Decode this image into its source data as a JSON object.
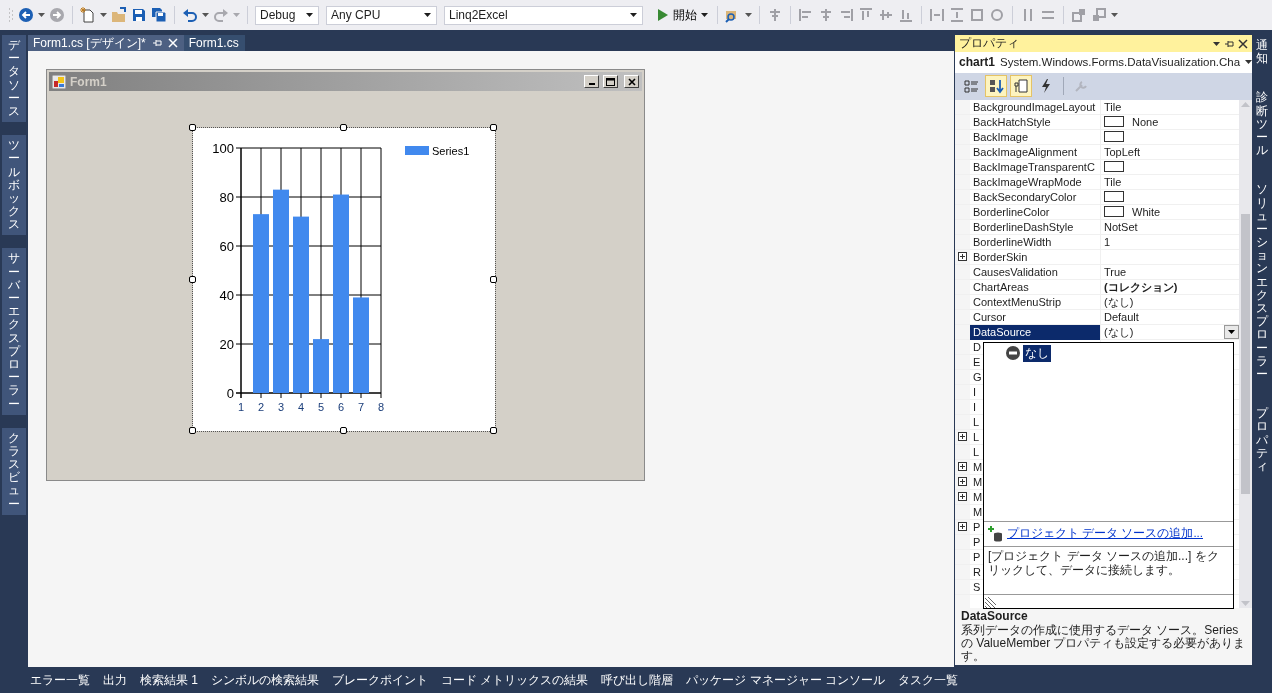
{
  "toolbar": {
    "configuration": "Debug",
    "platform": "Any CPU",
    "project": "Linq2Excel",
    "start_label": "開始"
  },
  "side_tabs_left": [
    "データソース",
    "ツールボックス",
    "サーバーエクスプローラー",
    "クラスビュー"
  ],
  "document_tabs": [
    {
      "label": "Form1.cs [デザイン]*",
      "selected": true
    },
    {
      "label": "Form1.cs",
      "selected": false
    }
  ],
  "form": {
    "title": "Form1",
    "chart": {
      "chart_data": {
        "type": "bar",
        "grid": true,
        "x": [
          2,
          3,
          4,
          5,
          6,
          7
        ],
        "xlim": [
          1,
          8
        ],
        "ylim": [
          0,
          100
        ],
        "xticks": [
          1,
          2,
          3,
          4,
          5,
          6,
          7,
          8
        ],
        "yticks": [
          0,
          20,
          40,
          60,
          80,
          100
        ],
        "series": [
          {
            "name": "Series1",
            "color": "#4189ee",
            "values": [
              73,
              83,
              72,
              22,
              81,
              39
            ]
          }
        ]
      }
    }
  },
  "properties": {
    "title": "プロパティ",
    "object_name": "chart1",
    "object_type": "System.Windows.Forms.DataVisualization.Cha",
    "toolbar": [
      {
        "kind": "categorized",
        "selected": false,
        "disabled": false
      },
      {
        "kind": "alphabetical",
        "selected": true,
        "disabled": false
      },
      {
        "kind": "property-pages",
        "selected": true,
        "disabled": false
      },
      {
        "kind": "events",
        "selected": false,
        "disabled": false
      },
      {
        "kind": "wrench",
        "selected": false,
        "disabled": true
      }
    ],
    "rows": [
      {
        "name": "BackgroundImageLayout",
        "value": "Tile",
        "swatch": false,
        "bold": false,
        "expander": false,
        "selected": false
      },
      {
        "name": "BackHatchStyle",
        "value": "None",
        "swatch": true,
        "bold": false,
        "expander": false,
        "selected": false
      },
      {
        "name": "BackImage",
        "swatch": true,
        "expander": false,
        "selected": false
      },
      {
        "name": "BackImageAlignment",
        "value": "TopLeft",
        "swatch": false,
        "bold": false,
        "expander": false,
        "selected": false
      },
      {
        "name": "BackImageTransparentC",
        "swatch": true,
        "expander": false,
        "selected": false
      },
      {
        "name": "BackImageWrapMode",
        "value": "Tile",
        "swatch": false,
        "bold": false,
        "expander": false,
        "selected": false
      },
      {
        "name": "BackSecondaryColor",
        "swatch": true,
        "expander": false,
        "selected": false
      },
      {
        "name": "BorderlineColor",
        "value": "White",
        "swatch": true,
        "bold": false,
        "expander": false,
        "selected": false
      },
      {
        "name": "BorderlineDashStyle",
        "value": "NotSet",
        "swatch": false,
        "bold": false,
        "expander": false,
        "selected": false
      },
      {
        "name": "BorderlineWidth",
        "value": "1",
        "swatch": false,
        "bold": false,
        "expander": false,
        "selected": false
      },
      {
        "name": "BorderSkin",
        "swatch": false,
        "expander": true,
        "selected": false
      },
      {
        "name": "CausesValidation",
        "value": "True",
        "swatch": false,
        "bold": false,
        "expander": false,
        "selected": false
      },
      {
        "name": "ChartAreas",
        "value": "(コレクション)",
        "swatch": false,
        "bold": true,
        "expander": false,
        "selected": false
      },
      {
        "name": "ContextMenuStrip",
        "value": "(なし)",
        "swatch": false,
        "bold": false,
        "expander": false,
        "selected": false
      },
      {
        "name": "Cursor",
        "value": "Default",
        "swatch": false,
        "bold": false,
        "expander": false,
        "selected": false
      },
      {
        "name": "DataSource",
        "value": "(なし)",
        "swatch": false,
        "bold": false,
        "expander": false,
        "selected": true
      },
      {
        "name": "D",
        "swatch": false,
        "expander": false,
        "selected": false
      },
      {
        "name": "E",
        "swatch": false,
        "expander": false,
        "selected": false
      },
      {
        "name": "G",
        "swatch": false,
        "expander": false,
        "selected": false
      },
      {
        "name": "I",
        "swatch": false,
        "expander": false,
        "selected": false
      },
      {
        "name": "I",
        "swatch": false,
        "expander": false,
        "selected": false
      },
      {
        "name": "L",
        "swatch": false,
        "expander": false,
        "selected": false
      },
      {
        "name": "L",
        "swatch": false,
        "expander": true,
        "selected": false
      },
      {
        "name": "L",
        "swatch": false,
        "expander": false,
        "selected": false
      },
      {
        "name": "M",
        "swatch": false,
        "expander": true,
        "selected": false
      },
      {
        "name": "M",
        "swatch": false,
        "expander": true,
        "selected": false
      },
      {
        "name": "M",
        "swatch": false,
        "expander": true,
        "selected": false
      },
      {
        "name": "M",
        "swatch": false,
        "expander": false,
        "selected": false
      },
      {
        "name": "P",
        "swatch": false,
        "expander": true,
        "selected": false
      },
      {
        "name": "P",
        "swatch": false,
        "expander": false,
        "selected": false
      },
      {
        "name": "P",
        "swatch": false,
        "expander": false,
        "selected": false
      },
      {
        "name": "R",
        "swatch": false,
        "expander": false,
        "selected": false
      },
      {
        "name": "S",
        "swatch": false,
        "expander": false,
        "selected": false
      }
    ],
    "dropdown": {
      "items": [
        {
          "label": "なし",
          "selected": true
        }
      ],
      "link": "プロジェクト データ ソースの追加...",
      "help": "[プロジェクト データ ソースの追加...] をクリックして、データに接続します。"
    },
    "description": {
      "title": "DataSource",
      "text": "系列データの作成に使用するデータ ソース。Series の ValueMember プロパティも設定する必要があります。"
    }
  },
  "side_tabs_right": [
    "通知",
    "診断ツール",
    "ソリューションエクスプローラー",
    "プロパティ"
  ],
  "bottom_tabs": [
    "エラー一覧",
    "出力",
    "検索結果 1",
    "シンボルの検索結果",
    "ブレークポイント",
    "コード メトリックスの結果",
    "呼び出し階層",
    "パッケージ マネージャー コンソール",
    "タスク一覧"
  ]
}
